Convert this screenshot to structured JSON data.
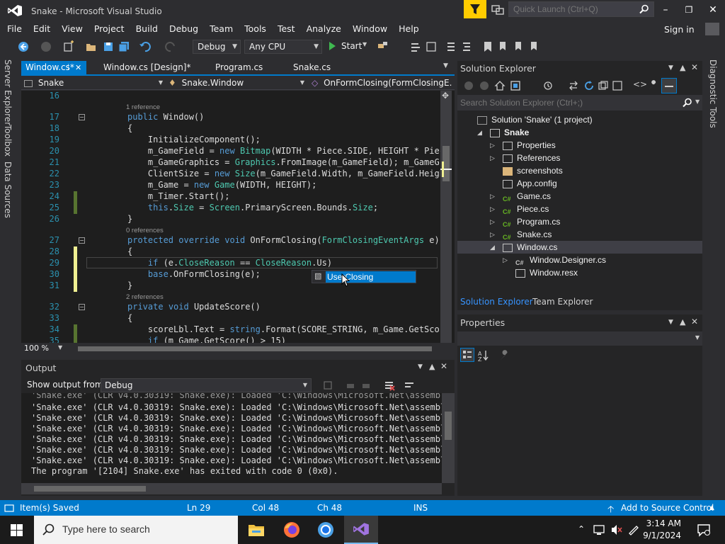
{
  "window": {
    "title": "Snake - Microsoft Visual Studio",
    "quick_launch_placeholder": "Quick Launch (Ctrl+Q)",
    "sign_in": "Sign in"
  },
  "menu": [
    "File",
    "Edit",
    "View",
    "Project",
    "Build",
    "Debug",
    "Team",
    "Tools",
    "Test",
    "Analyze",
    "Window",
    "Help"
  ],
  "toolbar": {
    "config": "Debug",
    "platform": "Any CPU",
    "start": "Start"
  },
  "left_strip": [
    "Server Explorer",
    "Toolbox",
    "Data Sources"
  ],
  "right_strip": [
    "Diagnostic Tools"
  ],
  "doc_tabs": [
    {
      "label": "Window.cs*",
      "active": true
    },
    {
      "label": "Window.cs [Design]*",
      "active": false
    },
    {
      "label": "Program.cs",
      "active": false
    },
    {
      "label": "Snake.cs",
      "active": false
    }
  ],
  "navbar": {
    "project": "Snake",
    "class": "Snake.Window",
    "member": "OnFormClosing(FormClosingE…"
  },
  "editor": {
    "zoom": "100 %",
    "lines": [
      {
        "num": "16",
        "text": ""
      },
      {
        "num": "17",
        "text": "public Window()",
        "refs": "1 reference"
      },
      {
        "num": "18",
        "text": "{"
      },
      {
        "num": "19",
        "text": "    InitializeComponent();"
      },
      {
        "num": "20",
        "text": "    m_GameField = new Bitmap(WIDTH * Piece.SIDE, HEIGHT * Piece"
      },
      {
        "num": "21",
        "text": "    m_GameGraphics = Graphics.FromImage(m_GameField); m_GameGra"
      },
      {
        "num": "22",
        "text": "    ClientSize = new Size(m_GameField.Width, m_GameField.Height"
      },
      {
        "num": "23",
        "text": "    m_Game = new Game(WIDTH, HEIGHT);"
      },
      {
        "num": "24",
        "text": "    m_Timer.Start();"
      },
      {
        "num": "25",
        "text": "    this.Size = Screen.PrimaryScreen.Bounds.Size;"
      },
      {
        "num": "26",
        "text": "}"
      },
      {
        "num": "27",
        "text": "protected override void OnFormClosing(FormClosingEventArgs e)",
        "refs": "0 references"
      },
      {
        "num": "28",
        "text": "{"
      },
      {
        "num": "29",
        "text": "    if (e.CloseReason == CloseReason.Us)"
      },
      {
        "num": "30",
        "text": "    base.OnFormClosing(e);"
      },
      {
        "num": "31",
        "text": "}"
      },
      {
        "num": "32",
        "text": "private void UpdateScore()",
        "refs": "2 references"
      },
      {
        "num": "33",
        "text": "{"
      },
      {
        "num": "34",
        "text": "    scoreLbl.Text = string.Format(SCORE_STRING, m_Game.GetScore"
      },
      {
        "num": "35",
        "text": "    if (m_Game.GetScore() > 15)"
      }
    ],
    "intellisense": "UserClosing"
  },
  "output": {
    "title": "Output",
    "show_from_label": "Show output from:",
    "show_from_value": "Debug",
    "lines": [
      "'Snake.exe' (CLR v4.0.30319: Snake.exe): Loaded 'C:\\Windows\\Microsoft.Net\\assembly\\",
      "'Snake.exe' (CLR v4.0.30319: Snake.exe): Loaded 'C:\\Windows\\Microsoft.Net\\assembly\\",
      "'Snake.exe' (CLR v4.0.30319: Snake.exe): Loaded 'C:\\Windows\\Microsoft.Net\\assembly\\",
      "'Snake.exe' (CLR v4.0.30319: Snake.exe): Loaded 'C:\\Windows\\Microsoft.Net\\assembly\\",
      "'Snake.exe' (CLR v4.0.30319: Snake.exe): Loaded 'C:\\Windows\\Microsoft.Net\\assembly\\",
      "'Snake.exe' (CLR v4.0.30319: Snake.exe): Loaded 'C:\\Windows\\Microsoft.Net\\assembly\\",
      "The program '[2104] Snake.exe' has exited with code 0 (0x0)."
    ]
  },
  "solution_explorer": {
    "title": "Solution Explorer",
    "search_placeholder": "Search Solution Explorer (Ctrl+;)",
    "items": [
      {
        "label": "Solution 'Snake' (1 project)",
        "indent": 0,
        "bold": false
      },
      {
        "label": "Snake",
        "indent": 1,
        "bold": true
      },
      {
        "label": "Properties",
        "indent": 2,
        "bold": false
      },
      {
        "label": "References",
        "indent": 2,
        "bold": false
      },
      {
        "label": "screenshots",
        "indent": 2,
        "bold": false
      },
      {
        "label": "App.config",
        "indent": 2,
        "bold": false
      },
      {
        "label": "Game.cs",
        "indent": 2,
        "bold": false
      },
      {
        "label": "Piece.cs",
        "indent": 2,
        "bold": false
      },
      {
        "label": "Program.cs",
        "indent": 2,
        "bold": false
      },
      {
        "label": "Snake.cs",
        "indent": 2,
        "bold": false
      },
      {
        "label": "Window.cs",
        "indent": 2,
        "bold": false,
        "selected": true
      },
      {
        "label": "Window.Designer.cs",
        "indent": 3,
        "bold": false
      },
      {
        "label": "Window.resx",
        "indent": 3,
        "bold": false
      }
    ],
    "tabs": [
      "Solution Explorer",
      "Team Explorer"
    ]
  },
  "properties": {
    "title": "Properties"
  },
  "status": {
    "message": "Item(s) Saved",
    "ln": "Ln 29",
    "col": "Col 48",
    "ch": "Ch 48",
    "mode": "INS",
    "source_control": "Add to Source Control"
  },
  "taskbar": {
    "search_placeholder": "Type here to search",
    "time": "3:14 AM",
    "date": "9/1/2024"
  },
  "colors": {
    "accent": "#007acc",
    "background": "#2d2d30",
    "editor_bg": "#1e1e1e"
  }
}
